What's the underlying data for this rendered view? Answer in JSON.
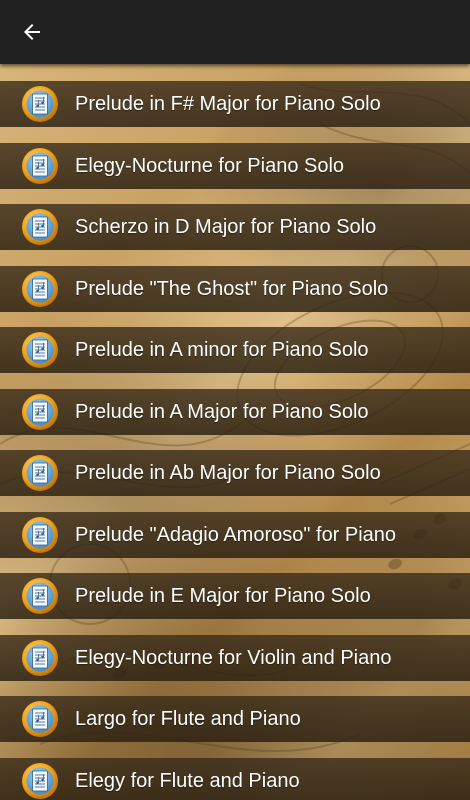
{
  "app_bar": {
    "back_icon": "arrow-back-icon",
    "background": "#212121"
  },
  "list_item_icon": "music-sheet-badge-icon",
  "items": [
    {
      "label": "Prelude in F# Major for Piano Solo"
    },
    {
      "label": "Elegy-Nocturne for Piano Solo"
    },
    {
      "label": "Scherzo in D Major for Piano Solo"
    },
    {
      "label": "Prelude \"The Ghost\" for Piano Solo"
    },
    {
      "label": "Prelude in A minor for Piano Solo"
    },
    {
      "label": "Prelude in A Major for Piano Solo"
    },
    {
      "label": "Prelude in Ab Major for Piano Solo"
    },
    {
      "label": "Prelude \"Adagio Amoroso\" for Piano"
    },
    {
      "label": "Prelude in E Major for Piano Solo"
    },
    {
      "label": "Elegy-Nocturne for Violin and Piano"
    },
    {
      "label": "Largo for Flute and Piano"
    },
    {
      "label": "Elegy for Flute and Piano"
    }
  ],
  "colors": {
    "row_band": "#3a2c1a",
    "icon_ring": "#f0a21c",
    "icon_face": "#5aa7d8",
    "text": "#ffffff"
  }
}
